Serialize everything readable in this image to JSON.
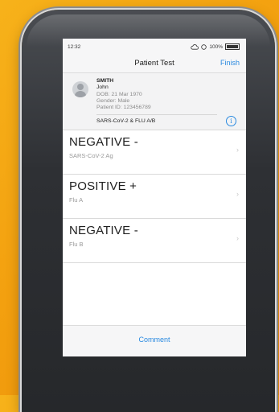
{
  "status_bar": {
    "time": "12:32",
    "battery": "100%"
  },
  "nav": {
    "title": "Patient Test",
    "finish_label": "Finish"
  },
  "patient": {
    "last_name": "SMITH",
    "first_name": "John",
    "dob": "DOB: 21 Mar 1970",
    "gender": "Gender: Male",
    "patient_id": "Patient ID: 123456789",
    "test_name": "SARS-CoV-2 & FLU A/B"
  },
  "results": [
    {
      "value": "NEGATIVE -",
      "analyte": "SARS-CoV-2 Ag"
    },
    {
      "value": "POSITIVE +",
      "analyte": "Flu A"
    },
    {
      "value": "NEGATIVE -",
      "analyte": "Flu B"
    }
  ],
  "footer": {
    "comment_label": "Comment"
  },
  "icons": {
    "info": "info-icon",
    "chevron": "chevron-right-icon",
    "avatar": "user-avatar-icon"
  },
  "colors": {
    "accent": "#2a8ae0",
    "background": "#f3a00f",
    "device": "#2e3034"
  }
}
